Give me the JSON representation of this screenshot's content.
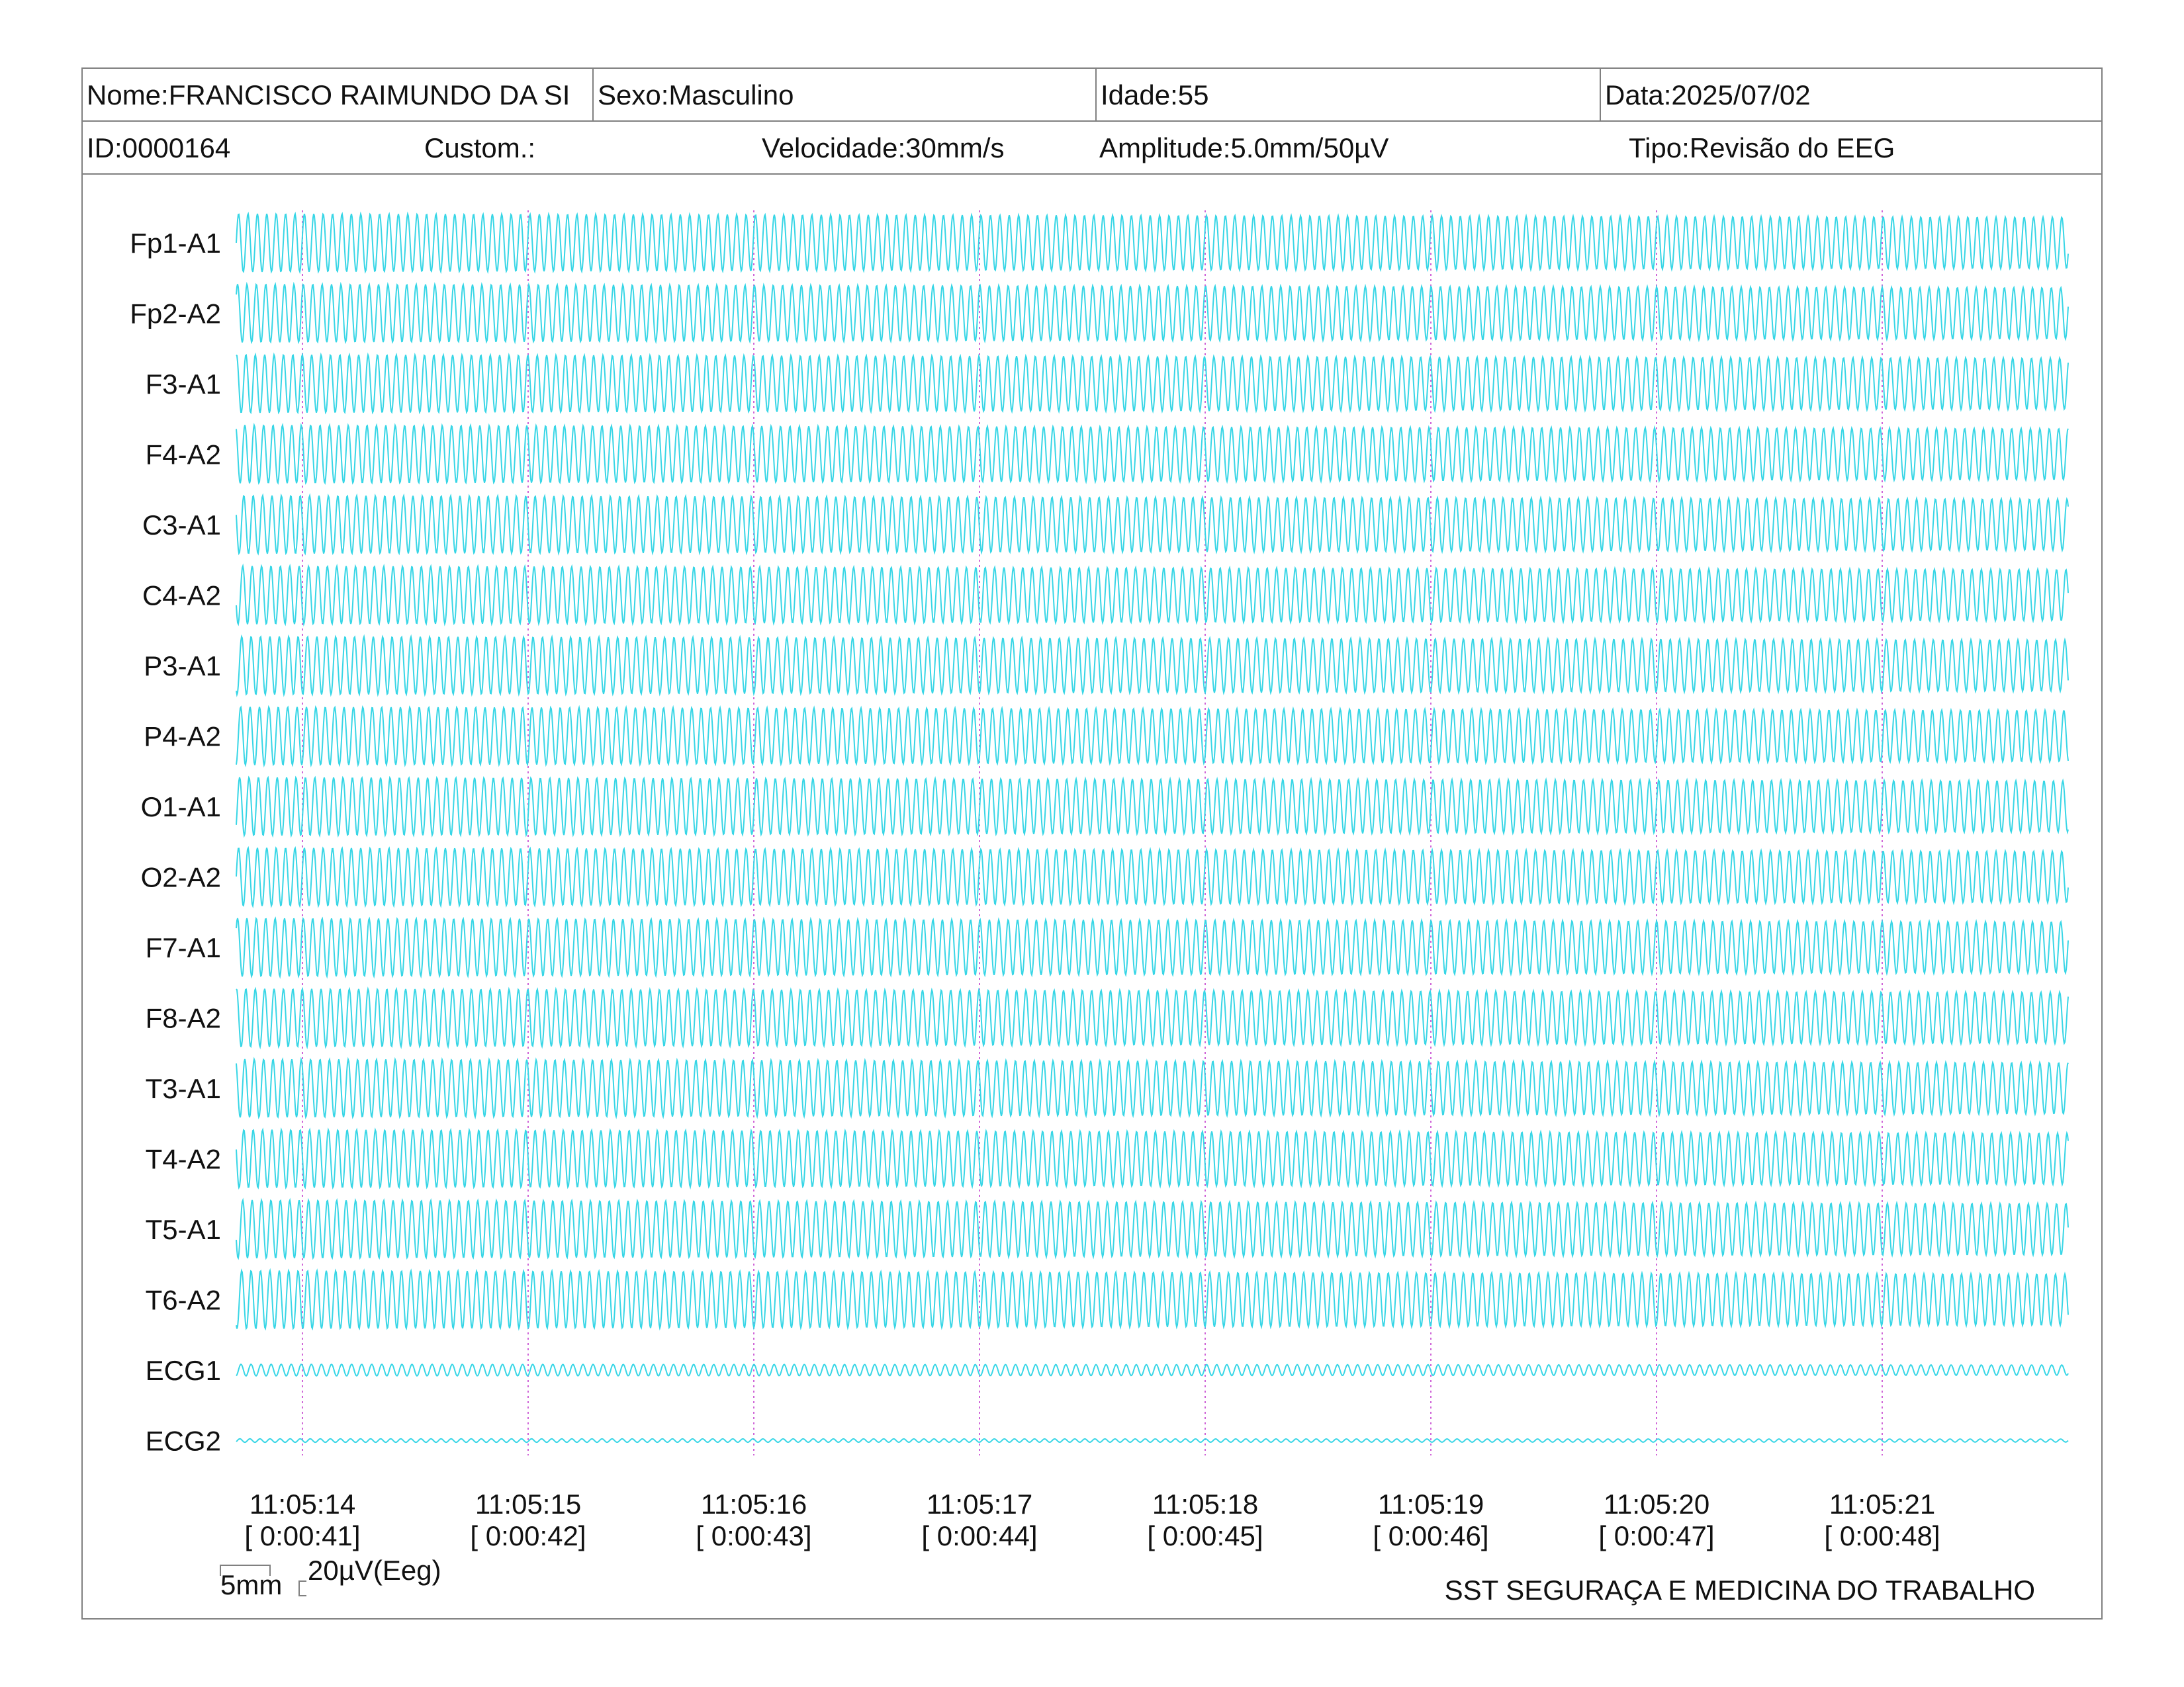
{
  "header": {
    "nome": "Nome:FRANCISCO RAIMUNDO DA SI",
    "sexo": "Sexo:Masculino",
    "idade": "Idade:55",
    "data": "Data:2025/07/02",
    "id": "ID:0000164",
    "custom": "Custom.:",
    "velocidade": "Velocidade:30mm/s",
    "amplitude": "Amplitude:5.0mm/50µV",
    "tipo": "Tipo:Revisão do EEG"
  },
  "channels": [
    {
      "label": "Fp1-A1",
      "amplitude_uV": 50
    },
    {
      "label": "Fp2-A2",
      "amplitude_uV": 50
    },
    {
      "label": "F3-A1",
      "amplitude_uV": 50
    },
    {
      "label": "F4-A2",
      "amplitude_uV": 50
    },
    {
      "label": "C3-A1",
      "amplitude_uV": 50
    },
    {
      "label": "C4-A2",
      "amplitude_uV": 50
    },
    {
      "label": "P3-A1",
      "amplitude_uV": 50
    },
    {
      "label": "P4-A2",
      "amplitude_uV": 50
    },
    {
      "label": "O1-A1",
      "amplitude_uV": 50
    },
    {
      "label": "O2-A2",
      "amplitude_uV": 50
    },
    {
      "label": "F7-A1",
      "amplitude_uV": 50
    },
    {
      "label": "F8-A2",
      "amplitude_uV": 50
    },
    {
      "label": "T3-A1",
      "amplitude_uV": 50
    },
    {
      "label": "T4-A2",
      "amplitude_uV": 50
    },
    {
      "label": "T5-A1",
      "amplitude_uV": 50
    },
    {
      "label": "T6-A2",
      "amplitude_uV": 50
    },
    {
      "label": "ECG1",
      "amplitude_uV": 10
    },
    {
      "label": "ECG2",
      "amplitude_uV": 3
    }
  ],
  "time_marks": [
    {
      "clock": "11:05:14",
      "elapsed": "[ 0:00:41]"
    },
    {
      "clock": "11:05:15",
      "elapsed": "[ 0:00:42]"
    },
    {
      "clock": "11:05:16",
      "elapsed": "[ 0:00:43]"
    },
    {
      "clock": "11:05:17",
      "elapsed": "[ 0:00:44]"
    },
    {
      "clock": "11:05:18",
      "elapsed": "[ 0:00:45]"
    },
    {
      "clock": "11:05:19",
      "elapsed": "[ 0:00:46]"
    },
    {
      "clock": "11:05:20",
      "elapsed": "[ 0:00:47]"
    },
    {
      "clock": "11:05:21",
      "elapsed": "[ 0:00:48]"
    }
  ],
  "calibration": {
    "time_label": "5mm",
    "amplitude_label": "20µV(Eeg)"
  },
  "footer": {
    "company": "SST SEGURAÇA E MEDICINA DO TRABALHO"
  },
  "colors": {
    "trace": "#38d6e6",
    "marker": "#d066d8",
    "border": "#808080"
  }
}
